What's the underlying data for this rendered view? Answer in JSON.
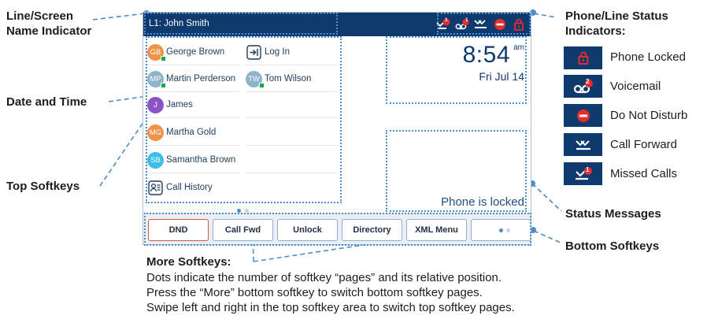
{
  "callouts": {
    "line_screen_name": [
      "Line/Screen",
      "Name Indicator"
    ],
    "status_indicators": [
      "Phone/Line Status",
      "Indicators:"
    ],
    "date_time": "Date and Time",
    "top_softkeys": "Top Softkeys",
    "status_messages": "Status Messages",
    "bottom_softkeys": "Bottom Softkeys",
    "more_softkeys": "More Softkeys:"
  },
  "more_softkeys_description": [
    "Dots indicate the number of softkey “pages” and its relative position.",
    "Press the “More” bottom softkey to switch bottom softkey pages.",
    "Swipe left and right in the top softkey area to switch top softkey pages."
  ],
  "legend": [
    {
      "icon": "lock-icon",
      "label": "Phone Locked"
    },
    {
      "icon": "voicemail-icon",
      "label": "Voicemail",
      "badge": "2"
    },
    {
      "icon": "do-not-disturb-icon",
      "label": "Do Not Disturb"
    },
    {
      "icon": "call-forward-icon",
      "label": "Call Forward"
    },
    {
      "icon": "missed-calls-icon",
      "label": "Missed Calls",
      "badge": "1"
    }
  ],
  "screen": {
    "line_label": "L1: John Smith",
    "header_icons": [
      {
        "icon": "missed-calls-icon",
        "badge": "1"
      },
      {
        "icon": "voicemail-icon",
        "badge": "1"
      },
      {
        "icon": "call-forward-icon"
      },
      {
        "icon": "do-not-disturb-icon"
      },
      {
        "icon": "lock-icon"
      }
    ],
    "contacts_left": [
      {
        "initials": "GB",
        "name": "George Brown",
        "color": "#f0924a",
        "presence": true
      },
      {
        "initials": "MP",
        "name": "Martin Perderson",
        "color": "#8fb3c8",
        "presence": true
      },
      {
        "initials": "J",
        "name": "James",
        "color": "#8c53c4",
        "presence": false
      },
      {
        "initials": "MG",
        "name": "Martha Gold",
        "color": "#f0924a",
        "presence": false
      },
      {
        "initials": "SB",
        "name": "Samantha Brown",
        "color": "#3bbfe6",
        "presence": false
      }
    ],
    "call_history_label": "Call History",
    "login_label": "Log In",
    "contact_right": {
      "initials": "TW",
      "name": "Tom Wilson",
      "color": "#8fb3c8",
      "presence": true
    },
    "time": "8:54",
    "ampm": "am",
    "date": "Fri Jul 14",
    "status_message": "Phone is locked",
    "softkeys": [
      "DND",
      "Call Fwd",
      "Unlock",
      "Directory",
      "XML Menu"
    ]
  },
  "colors": {
    "header_bg": "#0f3a6e",
    "callout_line": "#4f8cc9",
    "alert_red": "#e52d2d",
    "presence_green": "#19a94a"
  }
}
